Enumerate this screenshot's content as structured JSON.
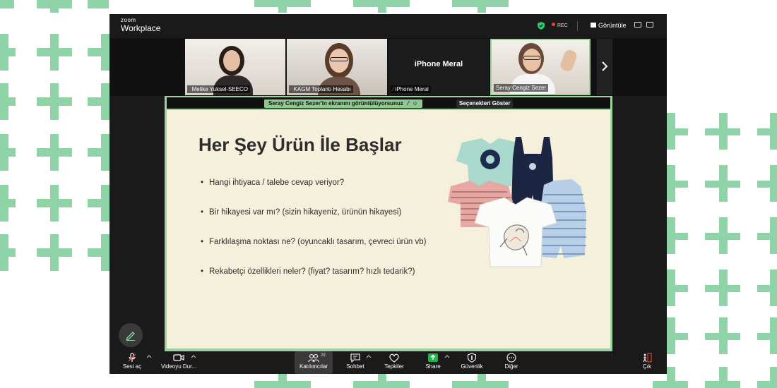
{
  "app": {
    "brand_small": "zoom",
    "brand_big": "Workplace"
  },
  "topbar": {
    "rec_label": "REC",
    "view_label": "Görüntüle"
  },
  "participants": [
    {
      "name": "Melike Yuksel-SEECO"
    },
    {
      "name": "KAGM Toplantı Hesabı"
    },
    {
      "name": "iPhone Meral",
      "center_label": "iPhone Meral"
    },
    {
      "name": "Seray Cengiz Sezer"
    }
  ],
  "share": {
    "banner": "Seray Cengiz Sezer'in ekranını görüntülüyorsunuz",
    "options_label": "Seçenekleri Göster"
  },
  "slide": {
    "title": "Her Şey Ürün İle Başlar",
    "bullets": [
      "Hangi ihtiyaca / talebe cevap veriyor?",
      "Bir hikayesi var mı? (sizin hikayeniz, ürünün hikayesi)",
      "Farklılaşma noktası ne?  (oyuncaklı tasarım, çevreci ürün vb)",
      "Rekabetçi özellikleri neler? (fiyat? tasarım? hızlı tedarik?)"
    ]
  },
  "toolbar": {
    "mic_label": "Sesi aç",
    "video_label": "Videoyu Dur...",
    "participants_label": "Katılımcılar",
    "participants_count": "29",
    "chat_label": "Sohbet",
    "reactions_label": "Tepkiler",
    "share_label": "Share",
    "security_label": "Güvenlik",
    "more_label": "Diğer",
    "leave_label": "Çık"
  },
  "colors": {
    "accent_green": "#8fd3a8",
    "share_border": "#9ed29e",
    "slide_bg": "#f5f0dc",
    "share_button": "#22b14c"
  },
  "icons": [
    "shield-check-icon",
    "record-dot-icon",
    "grid-view-icon",
    "mic-muted-icon",
    "video-camera-icon",
    "participants-icon",
    "chat-icon",
    "heart-icon",
    "share-arrow-icon",
    "shield-icon",
    "more-dots-icon",
    "leave-icon",
    "pencil-icon",
    "chevron-right-icon"
  ]
}
